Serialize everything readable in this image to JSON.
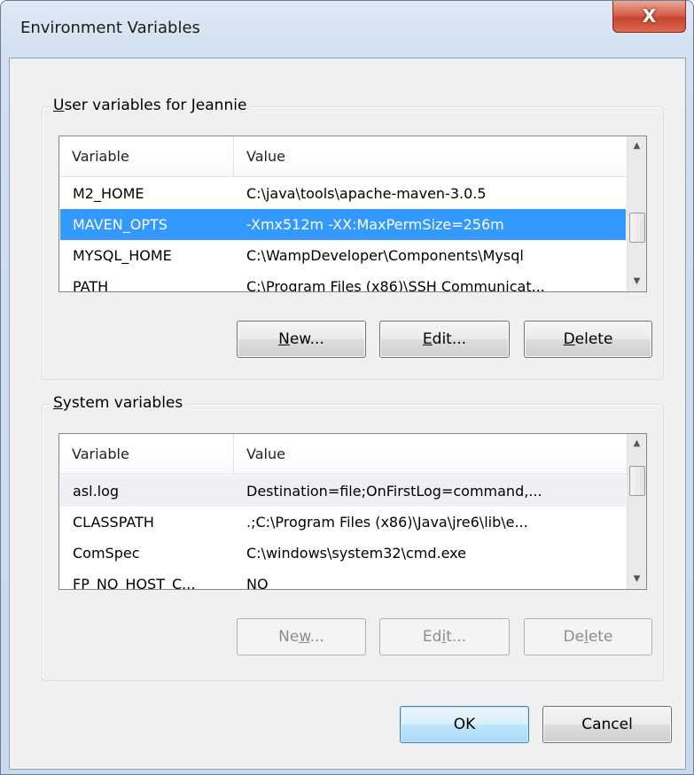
{
  "window": {
    "title": "Environment Variables",
    "close_glyph": "X"
  },
  "user_group": {
    "label": "User variables for Jeannie",
    "label_underline": "U",
    "label_rest": "ser variables for Jeannie",
    "columns": [
      "Variable",
      "Value"
    ],
    "rows": [
      {
        "variable": "M2_HOME",
        "value": "C:\\java\\tools\\apache-maven-3.0.5"
      },
      {
        "variable": "MAVEN_OPTS",
        "value": "-Xmx512m -XX:MaxPermSize=256m",
        "selected": true
      },
      {
        "variable": "MYSQL_HOME",
        "value": "C:\\WampDeveloper\\Components\\Mysql"
      },
      {
        "variable": "PATH",
        "value": "C:\\Program Files (x86)\\SSH Communicat..."
      }
    ],
    "buttons": {
      "new": {
        "pre": "",
        "u": "N",
        "post": "ew..."
      },
      "edit": {
        "pre": "",
        "u": "E",
        "post": "dit..."
      },
      "delete": {
        "pre": "",
        "u": "D",
        "post": "elete"
      }
    }
  },
  "system_group": {
    "label": "System variables",
    "label_underline": "S",
    "label_rest": "ystem variables",
    "columns": [
      "Variable",
      "Value"
    ],
    "rows": [
      {
        "variable": "asl.log",
        "value": "Destination=file;OnFirstLog=command,..."
      },
      {
        "variable": "CLASSPATH",
        "value": ".;C:\\Program Files (x86)\\Java\\jre6\\lib\\e..."
      },
      {
        "variable": "ComSpec",
        "value": "C:\\windows\\system32\\cmd.exe"
      },
      {
        "variable": "FP_NO_HOST_C...",
        "value": "NO"
      }
    ],
    "buttons": {
      "new": {
        "pre": "Ne",
        "u": "w",
        "post": "..."
      },
      "edit": {
        "pre": "Ed",
        "u": "i",
        "post": "t..."
      },
      "delete": {
        "pre": "De",
        "u": "l",
        "post": "ete"
      }
    }
  },
  "footer": {
    "ok": "OK",
    "cancel": "Cancel"
  }
}
